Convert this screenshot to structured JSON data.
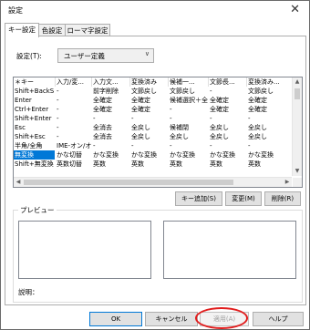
{
  "window": {
    "title": "設定",
    "close_glyph": "✕"
  },
  "tabs": [
    {
      "label": "キー設定",
      "active": true
    },
    {
      "label": "色設定",
      "active": false
    },
    {
      "label": "ローマ字設定",
      "active": false
    }
  ],
  "setting": {
    "label": "設定(T):",
    "value": "ユーザー定義"
  },
  "grid": {
    "columns": [
      "＊キー",
      "入力/変...",
      "入力文...",
      "変換済み",
      "候補一...",
      "文節長...",
      "変換済み..."
    ],
    "rows": [
      [
        "Shift+BackS",
        "-",
        "前字削除",
        "文節戻し",
        "文節戻し",
        "-",
        "文節戻し"
      ],
      [
        "Enter",
        "-",
        "全確定",
        "全確定",
        "候補選択＋全確定",
        "全確定",
        "全確定"
      ],
      [
        "Ctrl+Enter",
        "-",
        "全確定",
        "全確定",
        "-",
        "全確定",
        "全確定"
      ],
      [
        "Shift+Enter",
        "-",
        "-",
        "-",
        "-",
        "-",
        "-"
      ],
      [
        "Esc",
        "-",
        "全消去",
        "全戻し",
        "候補閉",
        "全戻し",
        "全戻し"
      ],
      [
        "Shift+Esc",
        "-",
        "全消去",
        "全戻し",
        "全戻し",
        "全戻し",
        "全戻し"
      ],
      [
        "半角/全角",
        "IME-オン/オフ",
        "-",
        "-",
        "-",
        "-",
        "-"
      ],
      [
        "無変換",
        "かな切替",
        "かな変換",
        "かな変換",
        "かな変換",
        "かな変換",
        "かな変換"
      ],
      [
        "Shift+無変換",
        "英数切替",
        "英数",
        "英数",
        "英数",
        "英数",
        "英数"
      ]
    ],
    "selected_row": 7
  },
  "buttons": {
    "add_key": "キー追加(S)",
    "change": "変更(M)",
    "delete": "削除(R)",
    "ok": "OK",
    "cancel": "キャンセル",
    "apply": "適用(A)",
    "help": "ヘルプ"
  },
  "preview": {
    "label": "プレビュー",
    "description_label": "説明："
  },
  "annotation": {
    "highlight_color": "#e11d1d"
  }
}
